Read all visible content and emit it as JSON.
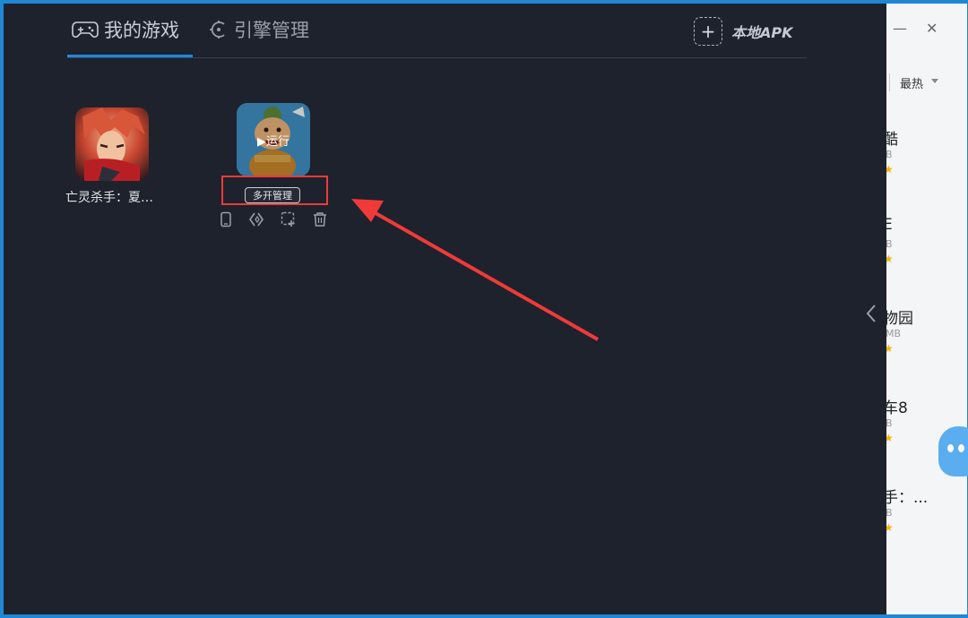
{
  "header": {
    "tab_my_games": "我的游戏",
    "tab_engine": "引擎管理",
    "local_apk": "本地APK",
    "local_apk_plus": "+"
  },
  "games": [
    {
      "title": "亡灵杀手：夏…",
      "icon": "game-icon-undead-slayer"
    },
    {
      "run_label": "▶运行",
      "multi_open_label": "多开管理",
      "icon": "game-icon-chinese-character"
    }
  ],
  "game_actions": [
    "phone-icon",
    "diamond-shortcut-icon",
    "add-to-desktop-icon",
    "trash-icon"
  ],
  "background_app": {
    "sort_label": "最热",
    "items": [
      {
        "name": "酷",
        "size": "B"
      },
      {
        "name": "E",
        "size": "B"
      },
      {
        "name": "物园",
        "size": "MB"
      },
      {
        "name": "车8",
        "size": "B"
      },
      {
        "name": "手：...",
        "size": "B"
      }
    ],
    "window_controls": [
      "—",
      "✕"
    ]
  },
  "colors": {
    "panel_bg": "#1e222c",
    "accent_blue": "#1e88e5",
    "highlight_red": "#ee3a3a",
    "frame_blue": "#1f87d6"
  }
}
